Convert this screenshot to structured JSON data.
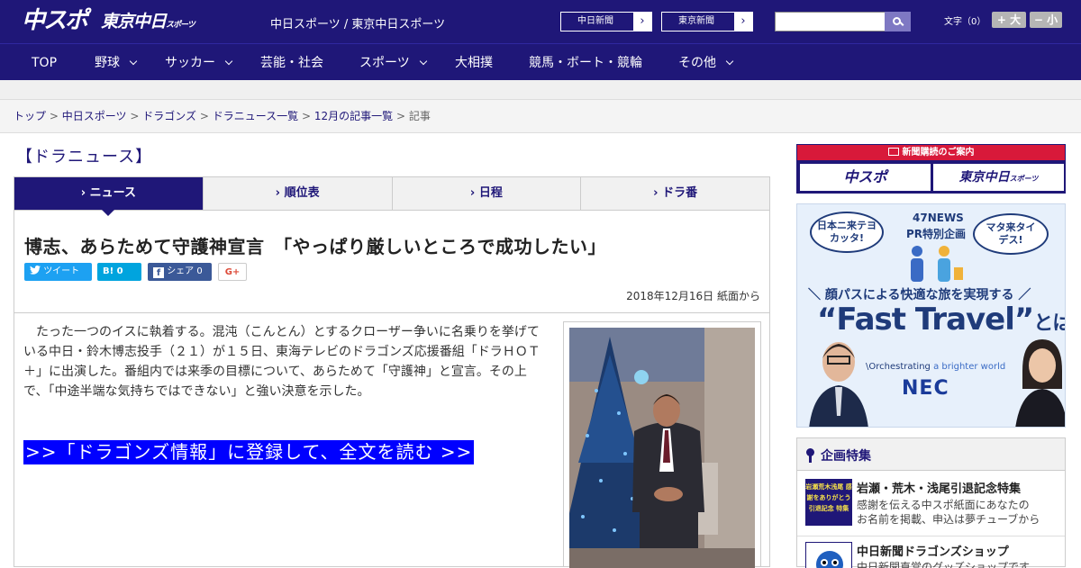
{
  "header": {
    "logo_chuspo": "中スポ",
    "logo_tokyo": "東京中日",
    "logo_tokyo_small": "スポーツ",
    "site_names": "中日スポーツ / 東京中日スポーツ",
    "partner_buttons": [
      {
        "label": "中日新聞",
        "arrow": "›"
      },
      {
        "label": "東京新聞",
        "arrow": "›"
      }
    ],
    "search_placeholder": "",
    "font_size_label": "文字（0）",
    "font_larger": "+ 大",
    "font_smaller": "− 小",
    "colors": {
      "brand": "#1f1778",
      "accent": "#d8193a",
      "cta": "#0000ff"
    }
  },
  "nav": {
    "items": [
      "TOP",
      "野球",
      "サッカー",
      "芸能・社会",
      "スポーツ",
      "大相撲",
      "競馬・ボート・競輪",
      "その他"
    ]
  },
  "breadcrumb": {
    "links": [
      "トップ",
      "中日スポーツ",
      "ドラゴンズ",
      "ドラニュース一覧",
      "12月の記事一覧"
    ],
    "separator": ">",
    "current": "記事"
  },
  "section_title": "【ドラニュース】",
  "tabs": [
    {
      "label": "ニュース",
      "active": true
    },
    {
      "label": "順位表",
      "active": false
    },
    {
      "label": "日程",
      "active": false
    },
    {
      "label": "ドラ番",
      "active": false
    }
  ],
  "article": {
    "headline": "博志、あらためて守護神宣言　「やっぱり厳しいところで成功したい」",
    "share": {
      "tweet": "ツイート",
      "hatena": "B!",
      "hatena_count": "0",
      "facebook": "シェア",
      "facebook_count": "0",
      "gplus": "G+"
    },
    "date": "2018年12月16日 紙面から",
    "body": "たった一つのイスに執着する。混沌（こんとん）とするクローザー争いに名乗りを挙げている中日・鈴木博志投手（２１）が１５日、東海テレビのドラゴンズ応援番組「ドラＨＯＴ＋」に出演した。番組内では来季の目標について、あらためて「守護神」と宣言。その上で、「中途半端な気持ちではできない」と強い決意を示した。",
    "cta": ">>「ドラゴンズ情報」に登録して、全文を読む >>"
  },
  "sidebar": {
    "subscription": {
      "header": "新聞購読のご案内",
      "buttons": [
        "中スポ",
        "東京中日"
      ],
      "small": "スポーツ"
    },
    "ad": {
      "bubble1": "日本ニ来テヨカッタ!",
      "center_top": "47NEWS",
      "center_bottom": "PR特別企画",
      "bubble2": "マタ来タイデス!",
      "tagline": "＼ 顔パスによる快適な旅を実現する ／",
      "big_left": "“Fast Travel”",
      "big_right": "とは?",
      "orchestrating": "\\Orchestrating",
      "orchestrating_rest": "a brighter world",
      "brand": "NEC"
    },
    "kikaku": {
      "header": "企画特集",
      "items": [
        {
          "thumb": "岩瀬荒木浅尾 感謝をありがとう 引退記念 特集",
          "title": "岩瀬・荒木・浅尾引退記念特集",
          "desc": [
            "感謝を伝える中スポ紙面にあなたの",
            "お名前を掲載、申込は夢チューブから"
          ]
        },
        {
          "title": "中日新聞ドラゴンズショップ",
          "desc": [
            "中日新聞直営のグッズショップです"
          ]
        }
      ]
    }
  }
}
